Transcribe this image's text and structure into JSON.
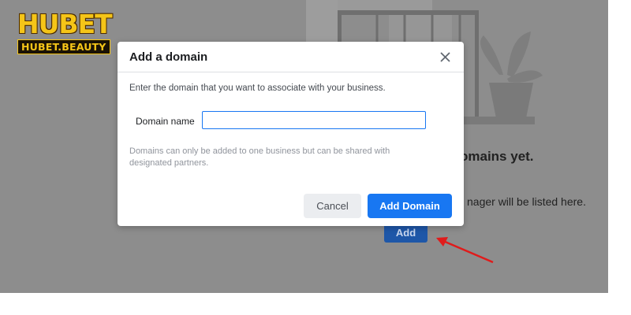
{
  "logo": {
    "main": "HUBET",
    "sub": "HUBET.BEAUTY"
  },
  "background": {
    "heading": "omains yet.",
    "subtext": "nager will be listed here.",
    "add_label": "Add"
  },
  "dialog": {
    "title": "Add a domain",
    "close_icon": "close-icon",
    "instruction": "Enter the domain that you want to associate with your business.",
    "field_label": "Domain name",
    "field_value": "",
    "field_placeholder": "",
    "hint": "Domains can only be added to one business but can be shared with designated partners.",
    "cancel_label": "Cancel",
    "submit_label": "Add Domain"
  },
  "colors": {
    "overlay": "#8d8d8d",
    "primary": "#1877f2",
    "annotation_arrow": "#e01b1b"
  }
}
